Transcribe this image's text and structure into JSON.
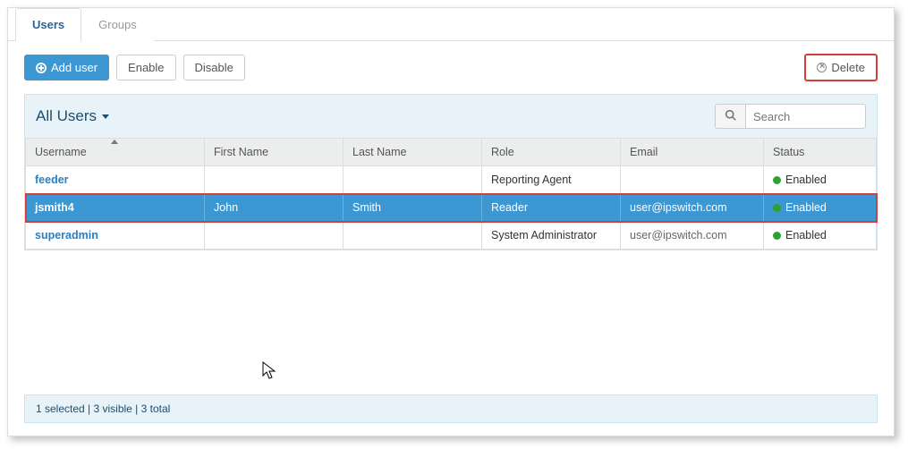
{
  "tabs": {
    "users": "Users",
    "groups": "Groups"
  },
  "toolbar": {
    "add_user": "Add user",
    "enable": "Enable",
    "disable": "Disable",
    "delete": "Delete"
  },
  "filter": {
    "title": "All Users",
    "search_placeholder": "Search"
  },
  "columns": {
    "username": "Username",
    "first_name": "First Name",
    "last_name": "Last Name",
    "role": "Role",
    "email": "Email",
    "status": "Status"
  },
  "rows": [
    {
      "username": "feeder",
      "first_name": "",
      "last_name": "",
      "role": "Reporting Agent",
      "email": "",
      "status": "Enabled",
      "selected": false
    },
    {
      "username": "jsmith4",
      "first_name": "John",
      "last_name": "Smith",
      "role": "Reader",
      "email": "user@ipswitch.com",
      "status": "Enabled",
      "selected": true
    },
    {
      "username": "superadmin",
      "first_name": "",
      "last_name": "",
      "role": "System Administrator",
      "email": "user@ipswitch.com",
      "status": "Enabled",
      "selected": false
    }
  ],
  "footer": "1 selected | 3 visible | 3 total"
}
